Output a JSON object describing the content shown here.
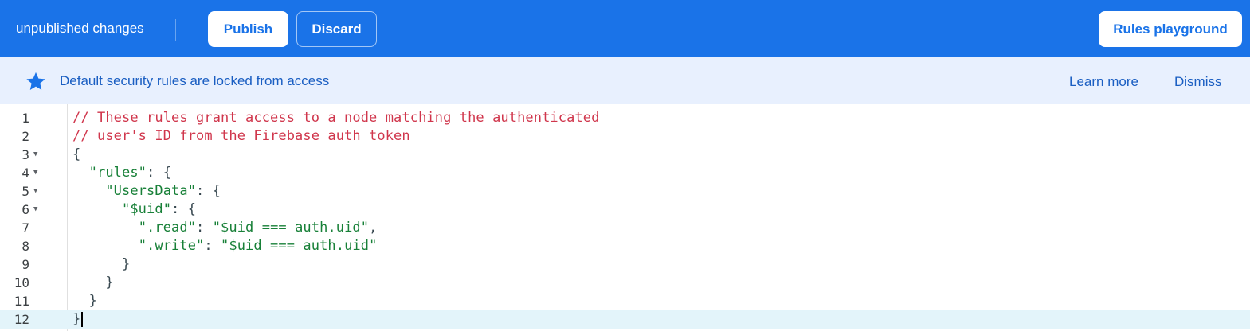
{
  "topbar": {
    "status_text": "unpublished changes",
    "publish_label": "Publish",
    "discard_label": "Discard",
    "playground_label": "Rules playground"
  },
  "banner": {
    "icon": "star-icon",
    "message": "Default security rules are locked from access",
    "learn_more_label": "Learn more",
    "dismiss_label": "Dismiss"
  },
  "editor": {
    "active_line": 12,
    "lines": [
      {
        "no": "1",
        "fold": false,
        "segments": [
          {
            "t": "// These rules grant access to a node matching the authenticated",
            "k": "comment"
          }
        ]
      },
      {
        "no": "2",
        "fold": false,
        "segments": [
          {
            "t": "// user's ID from the Firebase auth token",
            "k": "comment"
          }
        ]
      },
      {
        "no": "3",
        "fold": true,
        "segments": [
          {
            "t": "{",
            "k": "punct"
          }
        ]
      },
      {
        "no": "4",
        "fold": true,
        "segments": [
          {
            "t": "  ",
            "k": "punct"
          },
          {
            "t": "\"rules\"",
            "k": "key"
          },
          {
            "t": ": {",
            "k": "punct"
          }
        ]
      },
      {
        "no": "5",
        "fold": true,
        "segments": [
          {
            "t": "    ",
            "k": "punct"
          },
          {
            "t": "\"UsersData\"",
            "k": "key"
          },
          {
            "t": ": {",
            "k": "punct"
          }
        ]
      },
      {
        "no": "6",
        "fold": true,
        "segments": [
          {
            "t": "      ",
            "k": "punct"
          },
          {
            "t": "\"$uid\"",
            "k": "key"
          },
          {
            "t": ": {",
            "k": "punct"
          }
        ]
      },
      {
        "no": "7",
        "fold": false,
        "segments": [
          {
            "t": "        ",
            "k": "punct"
          },
          {
            "t": "\".read\"",
            "k": "key"
          },
          {
            "t": ": ",
            "k": "punct"
          },
          {
            "t": "\"$uid === auth.uid\"",
            "k": "string"
          },
          {
            "t": ",",
            "k": "punct"
          }
        ]
      },
      {
        "no": "8",
        "fold": false,
        "segments": [
          {
            "t": "        ",
            "k": "punct"
          },
          {
            "t": "\".write\"",
            "k": "key"
          },
          {
            "t": ": ",
            "k": "punct"
          },
          {
            "t": "\"$uid === auth.uid\"",
            "k": "string"
          }
        ]
      },
      {
        "no": "9",
        "fold": false,
        "segments": [
          {
            "t": "      }",
            "k": "punct"
          }
        ]
      },
      {
        "no": "10",
        "fold": false,
        "segments": [
          {
            "t": "    }",
            "k": "punct"
          }
        ]
      },
      {
        "no": "11",
        "fold": false,
        "segments": [
          {
            "t": "  }",
            "k": "punct"
          }
        ]
      },
      {
        "no": "12",
        "fold": false,
        "segments": [
          {
            "t": "}",
            "k": "punct"
          }
        ]
      }
    ]
  },
  "colors": {
    "topbar_bg": "#1a73e8",
    "banner_bg": "#e8f0fe",
    "comment": "#d0364c",
    "string": "#188038",
    "active_line_bg": "#e3f4fa"
  }
}
